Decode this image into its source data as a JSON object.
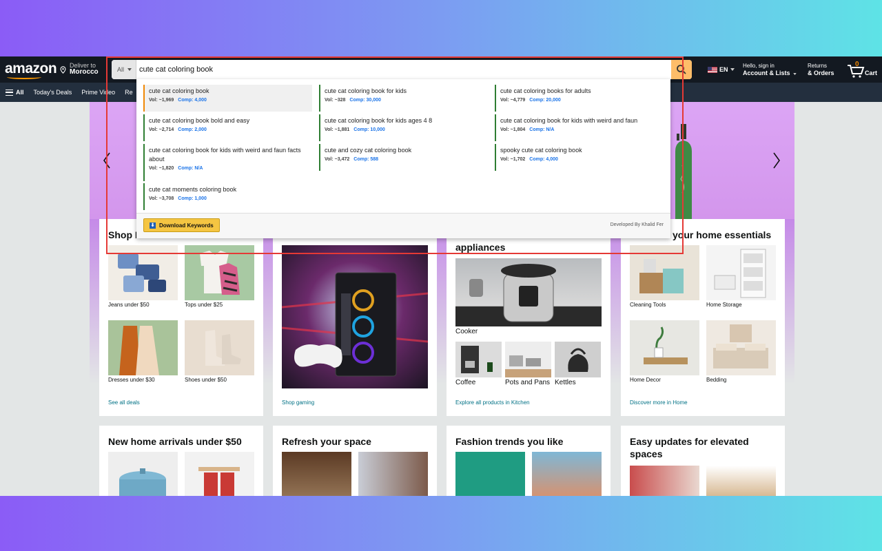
{
  "header": {
    "logo": "amazon",
    "deliver_to": "Deliver to",
    "location": "Morocco",
    "search_category": "All",
    "search_query": "cute cat coloring book",
    "language": "EN",
    "account_greeting": "Hello, sign in",
    "account_label": "Account & Lists",
    "returns": "Returns",
    "orders": "& Orders",
    "cart_count": "0",
    "cart_label": "Cart"
  },
  "subnav": {
    "all": "All",
    "items": [
      "Today's Deals",
      "Prime Video",
      "Re"
    ]
  },
  "keywords": {
    "items": [
      {
        "term": "cute cat coloring book",
        "vol": "Vol: ~1,969",
        "comp": "Comp: 4,000"
      },
      {
        "term": "cute cat coloring book for kids",
        "vol": "Vol: ~328",
        "comp": "Comp: 30,000"
      },
      {
        "term": "cute cat coloring books for adults",
        "vol": "Vol: ~4,779",
        "comp": "Comp: 20,000"
      },
      {
        "term": "cute cat coloring book bold and easy",
        "vol": "Vol: ~2,714",
        "comp": "Comp: 2,000"
      },
      {
        "term": "cute cat coloring book for kids ages 4 8",
        "vol": "Vol: ~1,881",
        "comp": "Comp: 10,000"
      },
      {
        "term": "cute cat coloring book for kids with weird and faun",
        "vol": "Vol: ~1,804",
        "comp": "Comp: N/A"
      },
      {
        "term": "cute cat coloring book for kids with weird and faun facts about",
        "vol": "Vol: ~1,820",
        "comp": "Comp: N/A"
      },
      {
        "term": "cute and cozy cat coloring book",
        "vol": "Vol: ~3,472",
        "comp": "Comp: 588"
      },
      {
        "term": "spooky cute cat coloring book",
        "vol": "Vol: ~1,702",
        "comp": "Comp: 4,000"
      },
      {
        "term": "cute cat moments coloring book",
        "vol": "Vol: ~3,708",
        "comp": "Comp: 1,000"
      }
    ],
    "download_label": "Download Keywords",
    "developer": "Developed By Khalid Fer"
  },
  "cards_row1": [
    {
      "title": "Shop I",
      "tiles": [
        "Jeans under $50",
        "Tops under $25",
        "Dresses under $30",
        "Shoes under $50"
      ],
      "link": "See all deals"
    },
    {
      "title": "",
      "link": "Shop gaming"
    },
    {
      "title": "appliances",
      "tiles": [
        "Cooker",
        "Coffee",
        "Pots and Pans",
        "Kettles"
      ],
      "link": "Explore all products in Kitchen"
    },
    {
      "title": "your home essentials",
      "tiles": [
        "Cleaning Tools",
        "Home Storage",
        "Home Decor",
        "Bedding"
      ],
      "link": "Discover more in Home"
    }
  ],
  "cards_row2": [
    {
      "title": "New home arrivals under $50"
    },
    {
      "title": "Refresh your space"
    },
    {
      "title": "Fashion trends you like"
    },
    {
      "title": "Easy updates for elevated spaces"
    }
  ]
}
